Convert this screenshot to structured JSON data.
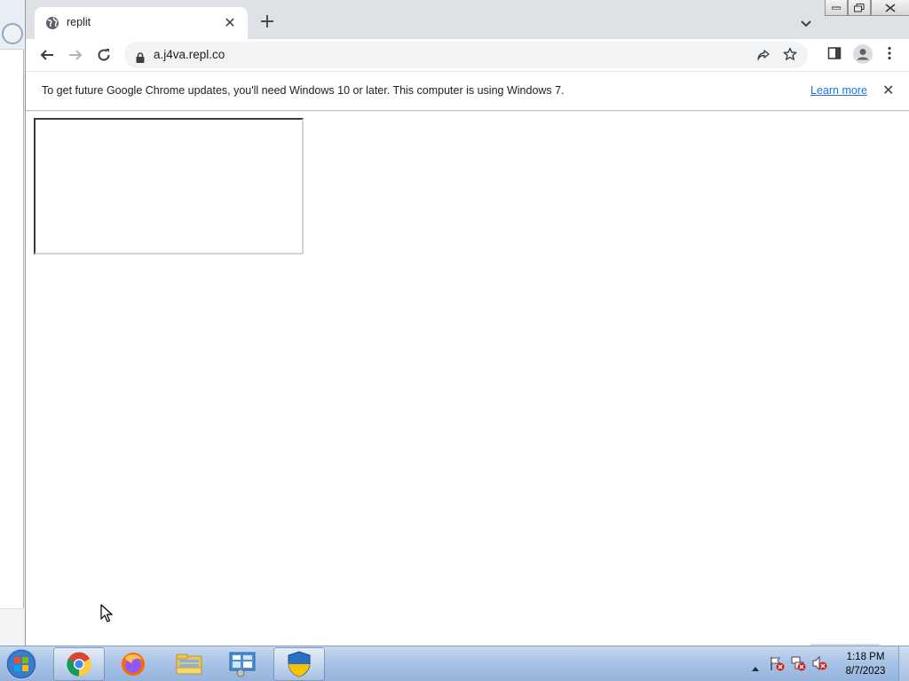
{
  "browser": {
    "tab": {
      "title": "replit",
      "close": "✕"
    },
    "new_tab": "+",
    "url": "a.j4va.repl.co"
  },
  "infobar": {
    "message": "To get future Google Chrome updates, you'll need Windows 10 or later. This computer is using Windows 7.",
    "link": "Learn more",
    "close": "✕"
  },
  "taskbar": {
    "items": [
      "chrome-icon",
      "firefox-icon",
      "file-explorer-icon",
      "control-panel-icon",
      "security-shield-icon"
    ],
    "clock": {
      "time": "1:18 PM",
      "date": "8/7/2023"
    }
  },
  "colors": {
    "link": "#1a73e8",
    "tabstrip": "#dee1e6",
    "omnibox": "#f1f3f4"
  }
}
